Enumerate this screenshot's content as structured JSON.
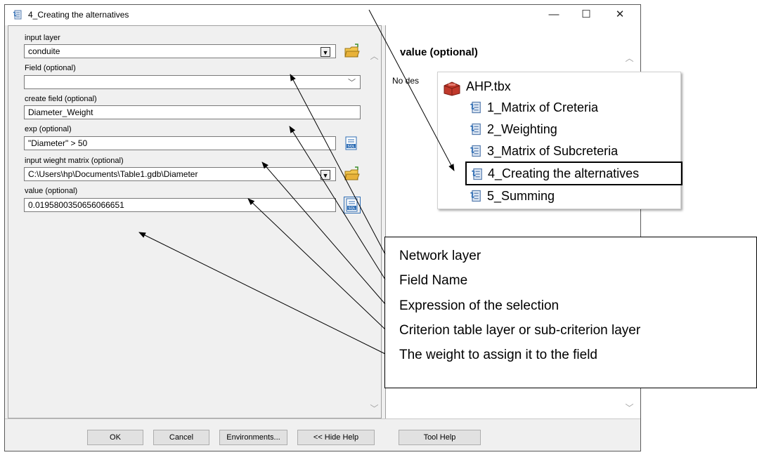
{
  "window": {
    "title": "4_Creating the alternatives",
    "minimize": "—",
    "maximize": "☐",
    "close": "✕"
  },
  "form": {
    "input_layer": {
      "label": "input layer",
      "value": "conduite"
    },
    "field": {
      "label": "Field (optional)",
      "value": ""
    },
    "create_field": {
      "label": "create field (optional)",
      "value": "Diameter_Weight"
    },
    "exp": {
      "label": "exp (optional)",
      "value": "\"Diameter\" > 50"
    },
    "input_matrix": {
      "label": "input wieght matrix (optional)",
      "value": "C:\\Users\\hp\\Documents\\Table1.gdb\\Diameter"
    },
    "value": {
      "label": "value (optional)",
      "value": "0.0195800350656066651"
    }
  },
  "help": {
    "title": "value (optional)",
    "body": "No des"
  },
  "buttons": {
    "ok": "OK",
    "cancel": "Cancel",
    "environments": "Environments...",
    "hide_help": "<< Hide Help",
    "tool_help": "Tool Help"
  },
  "toolbox": {
    "name": "AHP.tbx",
    "items": [
      "1_Matrix of Creteria",
      "2_Weighting",
      "3_Matrix of Subcreteria",
      "4_Creating the alternatives",
      "5_Summing"
    ],
    "selected_index": 3
  },
  "annotations": [
    "Network layer",
    "Field Name",
    "Expression of the selection",
    "Criterion table layer or sub-criterion layer",
    "The weight to assign it to the field"
  ],
  "colors": {
    "panel_bg": "#f0f0f0",
    "sql_icon": "#2e6db4",
    "folder_icon": "#e8b23a",
    "toolbox_icon": "#c0392b"
  }
}
